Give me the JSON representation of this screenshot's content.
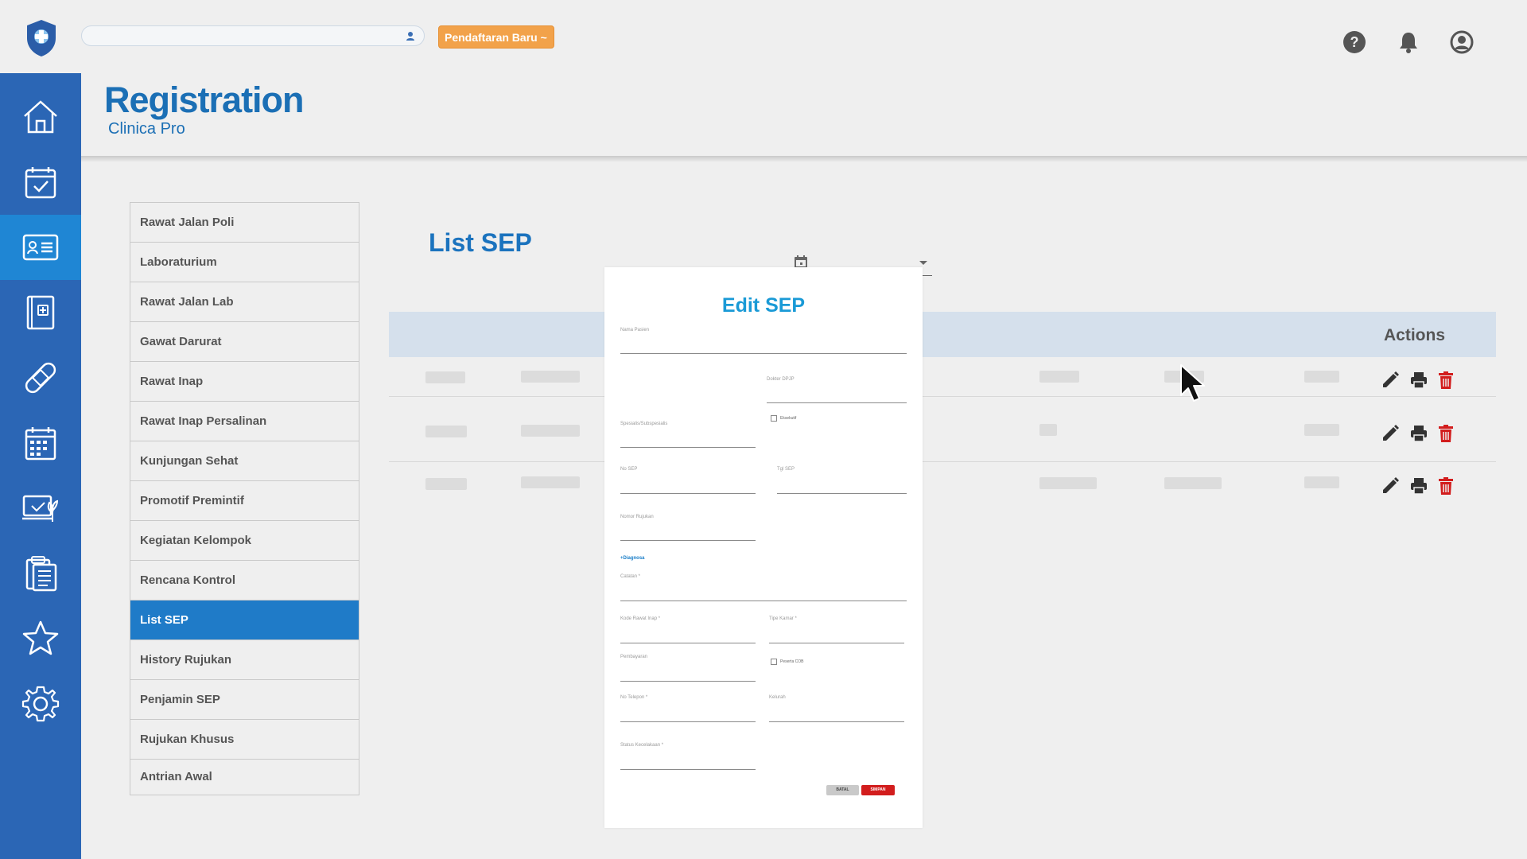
{
  "topbar": {
    "search": {
      "value": "",
      "placeholder": ""
    },
    "new_registration_label": "Pendaftaran Baru ~",
    "icons": [
      "help-icon",
      "bell-icon",
      "user-account-icon"
    ]
  },
  "rail": {
    "items": [
      "home-icon",
      "calendar-check-icon",
      "id-card-icon",
      "medical-book-icon",
      "bandage-icon",
      "calendar-grid-icon",
      "computer-plant-icon",
      "clipboard-list-icon",
      "star-icon",
      "gear-icon"
    ],
    "active_index": 2
  },
  "header": {
    "title": "Registration",
    "subtitle": "Clinica Pro"
  },
  "menu": {
    "items": [
      "Rawat Jalan Poli",
      "Laboraturium",
      "Rawat Jalan Lab",
      "Gawat Darurat",
      "Rawat Inap",
      "Rawat Inap Persalinan",
      "Kunjungan Sehat",
      "Promotif Premintif",
      "Kegiatan Kelompok",
      "Rencana Kontrol",
      "List SEP",
      "History Rujukan",
      "Penjamin SEP",
      "Rujukan Khusus",
      "Antrian Awal"
    ],
    "active_label": "List SEP"
  },
  "list": {
    "title": "List SEP",
    "actions_header": "Actions",
    "row_actions": [
      "edit-icon",
      "print-icon",
      "delete-icon"
    ]
  },
  "modal": {
    "title": "Edit SEP",
    "fields": {
      "nama_pasien": "Nama Pasien",
      "dokter_dpjp": "Dokter DPJP",
      "eksekutif": "Eksekutif",
      "spesialis": "Spesialis/Subspesialis",
      "no_sep": "No SEP",
      "tgl_sep": "Tgl SEP",
      "nomor_rujukan": "Nomor Rujukan",
      "diagnosa": "+Diagnosa",
      "catatan": "Catatan *",
      "kode_rawat_inap": "Kode Rawat Inap *",
      "tipe_kamar": "Tipe Kamar *",
      "pembayaran": "Pembayaran",
      "peserta_cob": "Peserta COB",
      "no_telepon": "No Telepon *",
      "kelurah": "Kelurah",
      "status_kecelakaan": "Status Kecelakaan *"
    },
    "cancel_label": "BATAL",
    "save_label": "SIMPAN"
  },
  "colors": {
    "rail": "#2b66b5",
    "rail_active": "#1f86d4",
    "accent": "#1b73be",
    "menu_active": "#1f7bc8",
    "orange": "#f2a24a",
    "delete": "#d21d1d"
  }
}
